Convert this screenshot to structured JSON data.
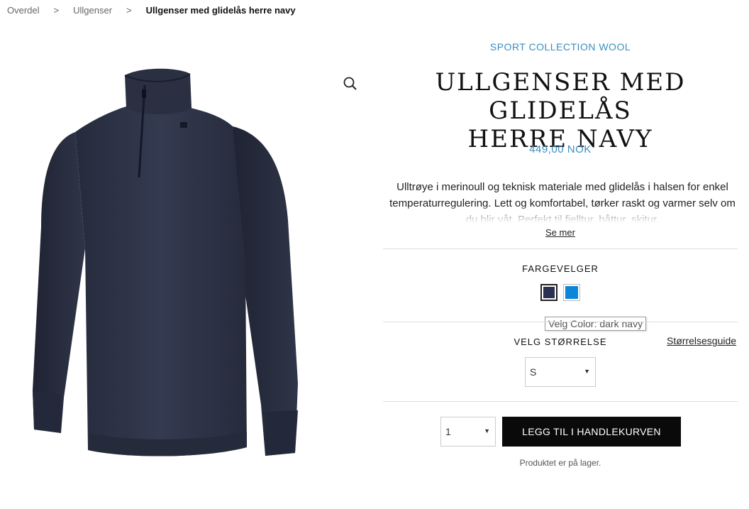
{
  "breadcrumb": {
    "items": [
      "Overdel",
      "Ullgenser"
    ],
    "separator": ">",
    "current": "Ullgenser med glidelås herre navy"
  },
  "product": {
    "collection": "SPORT COLLECTION WOOL",
    "title_line1": "ULLGENSER MED GLIDELÅS",
    "title_line2": "HERRE NAVY",
    "price": "449,00 NOK",
    "description": "Ulltrøye i merinoull og teknisk materiale med glidelås i halsen for enkel temperaturregulering. Lett og komfortabel, tørker raskt og varmer selv om du blir våt. Perfekt til fjelltur, båttur, skitur.",
    "see_more": "Se mer",
    "image_icon": "navy-zip-sweater-image",
    "zoom_icon": "zoom-icon"
  },
  "color_picker": {
    "label": "FARGEVELGER",
    "swatches": [
      {
        "name": "dark navy",
        "color": "#2b3150",
        "selected": true
      },
      {
        "name": "blue",
        "color": "#0b86d8",
        "selected": false
      }
    ],
    "tooltip": "Velg Color: dark navy"
  },
  "size": {
    "label": "VELG STØRRELSE",
    "guide_link": "Størrelsesguide",
    "selected": "S"
  },
  "cart": {
    "quantity": "1",
    "add_button": "LEGG TIL I HANDLEKURVEN",
    "stock_status": "Produktet er på lager."
  },
  "colors": {
    "accent": "#3a8dbf",
    "button_bg": "#0a0a0a",
    "sweater": "#2e3448"
  }
}
